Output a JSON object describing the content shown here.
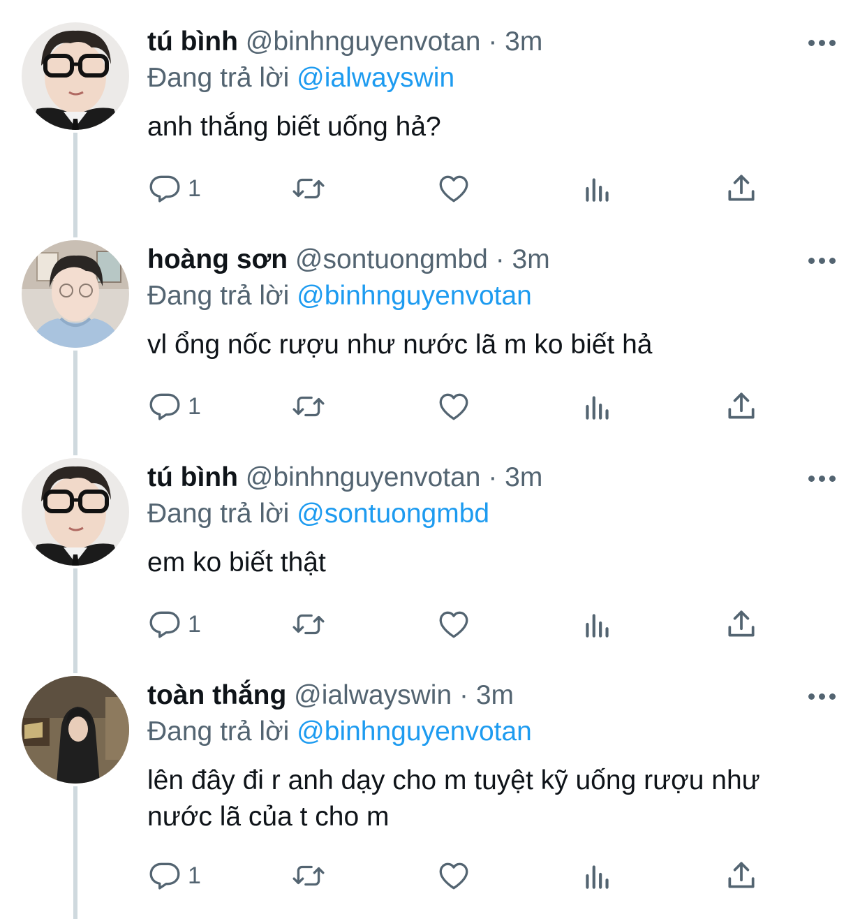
{
  "tweets": [
    {
      "name": "tú bình",
      "handle": "@binhnguyenvotan",
      "separator": "·",
      "time": "3m",
      "reply_prefix": "Đang trả lời",
      "reply_to": "@ialwayswin",
      "text": "anh thắng biết uống hả?",
      "reply_count": "1"
    },
    {
      "name": "hoàng sơn",
      "handle": "@sontuongmbd",
      "separator": "·",
      "time": "3m",
      "reply_prefix": "Đang trả lời",
      "reply_to": "@binhnguyenvotan",
      "text": "vl ổng nốc rượu như nước lã m ko biết hả",
      "reply_count": "1"
    },
    {
      "name": "tú bình",
      "handle": "@binhnguyenvotan",
      "separator": "·",
      "time": "3m",
      "reply_prefix": "Đang trả lời",
      "reply_to": "@sontuongmbd",
      "text": "em ko biết thật",
      "reply_count": "1"
    },
    {
      "name": "toàn thắng",
      "handle": "@ialwayswin",
      "separator": "·",
      "time": "3m",
      "reply_prefix": "Đang trả lời",
      "reply_to": "@binhnguyenvotan",
      "text_line1": "lên đây đi r anh dạy cho m tuyệt kỹ uống rượu như",
      "text_line2": "nước lã của t cho m",
      "reply_count": "1"
    }
  ],
  "icons": {
    "reply": "reply-icon",
    "retweet": "retweet-icon",
    "like": "heart-icon",
    "views": "analytics-icon",
    "share": "share-icon",
    "more": "more-icon"
  },
  "colors": {
    "text": "#0f1419",
    "secondary": "#536471",
    "mention": "#1d9bf0",
    "thread_line": "#cfd9de"
  }
}
